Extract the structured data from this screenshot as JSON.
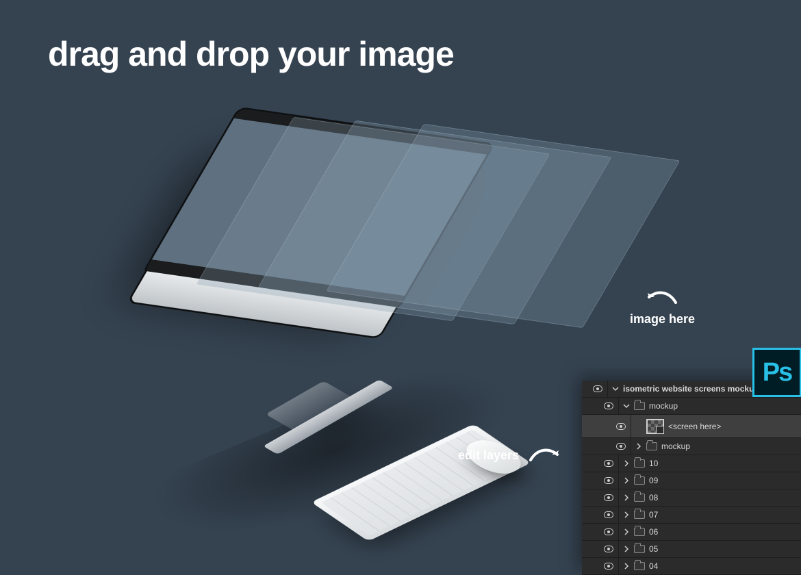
{
  "headline": "drag and drop your image",
  "callouts": {
    "image_here": "image here",
    "edit_layers": "edit layers"
  },
  "ps_badge": "Ps",
  "layers_panel": {
    "rows": [
      {
        "label": "isometric website screens mockup",
        "indent": 1,
        "twisty": "down",
        "icon": "none",
        "top": true,
        "selected": false,
        "tall": false
      },
      {
        "label": "mockup",
        "indent": 2,
        "twisty": "down",
        "icon": "folder",
        "top": false,
        "selected": false,
        "tall": false
      },
      {
        "label": "<screen here>",
        "indent": 3,
        "twisty": "none",
        "icon": "smartobj",
        "top": false,
        "selected": true,
        "tall": true
      },
      {
        "label": "mockup",
        "indent": 3,
        "twisty": "right",
        "icon": "folder",
        "top": false,
        "selected": false,
        "tall": false
      },
      {
        "label": "10",
        "indent": 2,
        "twisty": "right",
        "icon": "folder",
        "top": false,
        "selected": false,
        "tall": false
      },
      {
        "label": "09",
        "indent": 2,
        "twisty": "right",
        "icon": "folder",
        "top": false,
        "selected": false,
        "tall": false
      },
      {
        "label": "08",
        "indent": 2,
        "twisty": "right",
        "icon": "folder",
        "top": false,
        "selected": false,
        "tall": false
      },
      {
        "label": "07",
        "indent": 2,
        "twisty": "right",
        "icon": "folder",
        "top": false,
        "selected": false,
        "tall": false
      },
      {
        "label": "06",
        "indent": 2,
        "twisty": "right",
        "icon": "folder",
        "top": false,
        "selected": false,
        "tall": false
      },
      {
        "label": "05",
        "indent": 2,
        "twisty": "right",
        "icon": "folder",
        "top": false,
        "selected": false,
        "tall": false
      },
      {
        "label": "04",
        "indent": 2,
        "twisty": "right",
        "icon": "folder",
        "top": false,
        "selected": false,
        "tall": false
      }
    ]
  }
}
